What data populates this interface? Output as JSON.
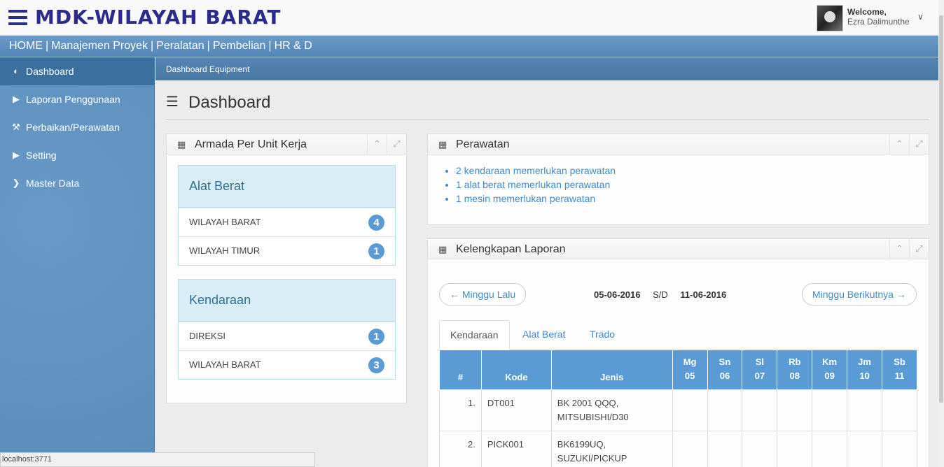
{
  "app": {
    "brand": "MDK-WILAYAH BARAT"
  },
  "user": {
    "welcome": "Welcome,",
    "name": "Ezra Dalimunthe"
  },
  "mainnav": {
    "items": [
      "HOME",
      "Manajemen Proyek",
      "Peralatan",
      "Pembelian",
      "HR & D"
    ],
    "separator": "|"
  },
  "sidebar": {
    "items": [
      {
        "label": "Dashboard",
        "icon": "dashboard-icon"
      },
      {
        "label": "Laporan Penggunaan",
        "icon": "play-icon"
      },
      {
        "label": "Perbaikan/Perawatan",
        "icon": "wrench-icon"
      },
      {
        "label": "Setting",
        "icon": "play-icon"
      },
      {
        "label": "Master Data",
        "icon": "chevron-right-icon"
      }
    ]
  },
  "breadcrumb": "Dashboard Equipment",
  "page": {
    "title": "Dashboard"
  },
  "armada": {
    "title": "Armada Per Unit Kerja",
    "groups": [
      {
        "title": "Alat Berat",
        "rows": [
          {
            "label": "WILAYAH BARAT",
            "count": "4"
          },
          {
            "label": "WILAYAH TIMUR",
            "count": "1"
          }
        ]
      },
      {
        "title": "Kendaraan",
        "rows": [
          {
            "label": "DIREKSI",
            "count": "1"
          },
          {
            "label": "WILAYAH BARAT",
            "count": "3"
          }
        ]
      }
    ]
  },
  "perawatan": {
    "title": "Perawatan",
    "items": [
      "2 kendaraan memerlukan perawatan",
      "1 alat berat memerlukan perawatan",
      "1 mesin memerlukan perawatan"
    ]
  },
  "kelengkapan": {
    "title": "Kelengkapan Laporan",
    "prev": "← Minggu Lalu",
    "next": "Minggu Berikutnya →",
    "date_from": "05-06-2016",
    "sd": "S/D",
    "date_to": "11-06-2016",
    "tabs": [
      "Kendaraan",
      "Alat Berat",
      "Trado"
    ],
    "columns": {
      "no": "#",
      "kode": "Kode",
      "jenis": "Jenis"
    },
    "days": [
      {
        "d": "Mg",
        "n": "05"
      },
      {
        "d": "Sn",
        "n": "06"
      },
      {
        "d": "Sl",
        "n": "07"
      },
      {
        "d": "Rb",
        "n": "08"
      },
      {
        "d": "Km",
        "n": "09"
      },
      {
        "d": "Jm",
        "n": "10"
      },
      {
        "d": "Sb",
        "n": "11"
      }
    ],
    "rows": [
      {
        "no": "1.",
        "kode": "DT001",
        "jenis1": "BK 2001 QQQ,",
        "jenis2": "MITSUBISHI/D30"
      },
      {
        "no": "2.",
        "kode": "PICK001",
        "jenis1": "BK6199UQ,",
        "jenis2": "SUZUKI/PICKUP"
      }
    ]
  },
  "statusbar": "localhost:3771"
}
